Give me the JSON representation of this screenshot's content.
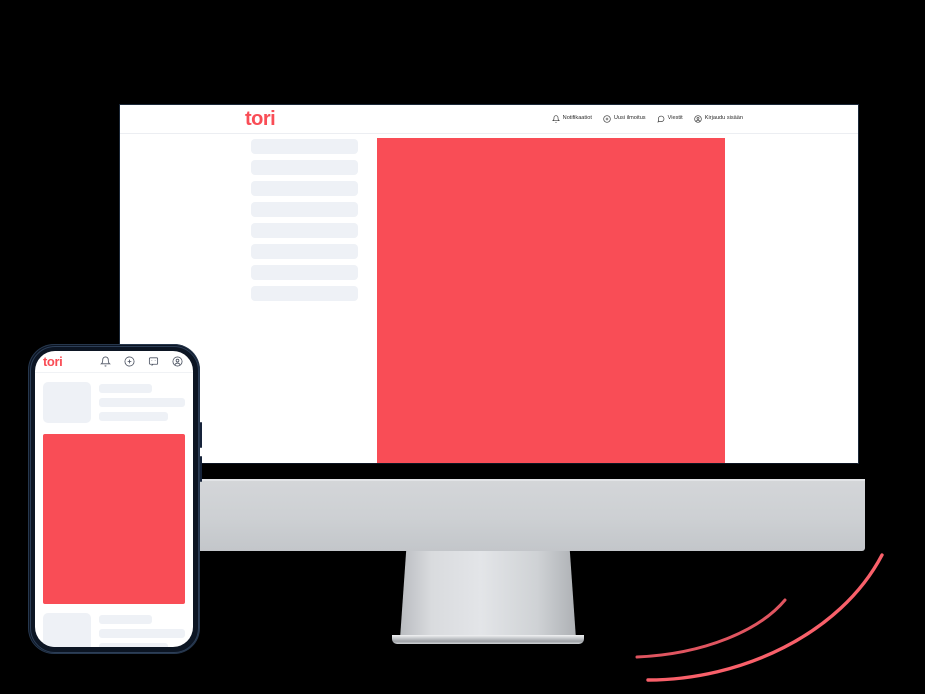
{
  "scene": {
    "background_color": "#000000",
    "accent_color": "#F94D56",
    "skeleton_color": "#EEF1F6"
  },
  "desktop": {
    "device": "desktop-monitor",
    "site_header": {
      "logo_text": "tori",
      "logo_color": "#F94D56",
      "nav_items": [
        {
          "label": "Notifikaatiot",
          "icon": "bell-icon"
        },
        {
          "label": "Uusi ilmoitus",
          "icon": "plus-circle-icon"
        },
        {
          "label": "Viestit",
          "icon": "message-icon"
        },
        {
          "label": "Kirjaudu sisään",
          "icon": "user-circle-icon"
        }
      ]
    },
    "sidebar": {
      "placeholder_row_count": 8
    },
    "content": {
      "block_color": "#F94D56"
    }
  },
  "mobile": {
    "device": "smartphone",
    "app_header": {
      "logo_text": "tori",
      "logo_color": "#F94D56",
      "icons": [
        {
          "name": "bell-icon"
        },
        {
          "name": "plus-circle-icon"
        },
        {
          "name": "message-icon"
        },
        {
          "name": "user-circle-icon"
        }
      ]
    },
    "content": {
      "block_color": "#F94D56",
      "top_card_lines": 3,
      "bottom_card_lines": 3
    }
  },
  "decoration": {
    "arcs": [
      {
        "name": "outer-red-arc",
        "color": "#F9606A"
      },
      {
        "name": "inner-red-arc",
        "color": "#E05560"
      }
    ]
  }
}
